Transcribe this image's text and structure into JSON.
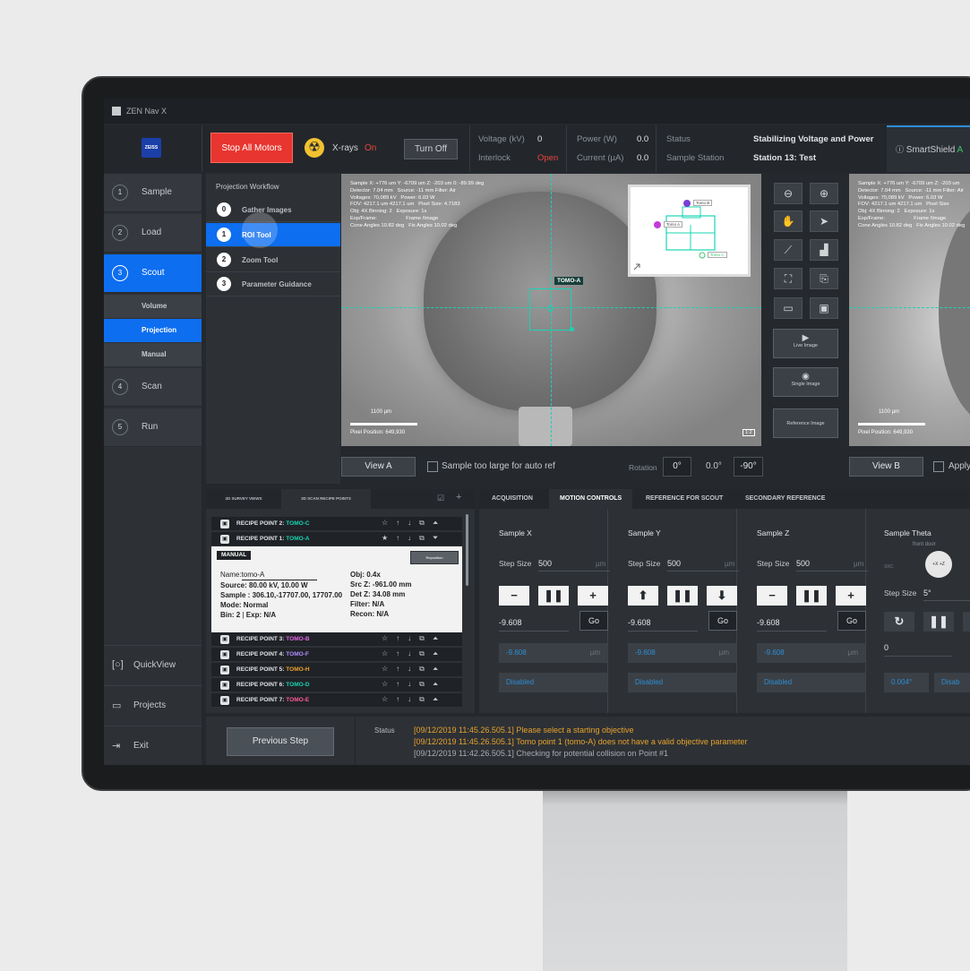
{
  "app_title": "ZEN Nav X",
  "brand": "ZEISS",
  "colors": {
    "accent": "#0d6ef0",
    "danger": "#e8352f",
    "teal": "#18d4b4",
    "warning": "#e8a22b"
  },
  "header": {
    "stop_all_motors": "Stop All Motors",
    "xrays_label": "X-rays",
    "xrays_state": "On",
    "turn_off": "Turn Off",
    "voltage_label": "Voltage (kV)",
    "voltage_value": "0",
    "interlock_label": "Interlock",
    "interlock_value": "Open",
    "power_label": "Power (W)",
    "power_value": "0.0",
    "current_label": "Current (µA)",
    "current_value": "0.0",
    "status_label": "Status",
    "status_value": "Stabilizing Voltage and Power",
    "station_label": "Sample Station",
    "station_value": "Station 13: Test",
    "smartshield": "SmartShield",
    "smartshield_tail": "A"
  },
  "nav": {
    "items": [
      {
        "num": "1",
        "label": "Sample"
      },
      {
        "num": "2",
        "label": "Load"
      },
      {
        "num": "3",
        "label": "Scout"
      },
      {
        "num": "4",
        "label": "Scan"
      },
      {
        "num": "5",
        "label": "Run"
      }
    ],
    "sub": [
      "Volume",
      "Projection",
      "Manual"
    ],
    "bottom": [
      "QuickView",
      "Projects",
      "Exit"
    ]
  },
  "workflow": {
    "title": "Projection Workflow",
    "steps": [
      {
        "num": "0",
        "label": "Gather Images"
      },
      {
        "num": "1",
        "label": "ROI Tool"
      },
      {
        "num": "2",
        "label": "Zoom Tool"
      },
      {
        "num": "3",
        "label": "Parameter Guidance"
      }
    ]
  },
  "viewA": {
    "info": "Sample X: +776 um Y: -6709 um Z: -203 um 0: -89.99 deg\nDetector: 7.04 mm   Source: -11 mm Filter: Air\nVoltages: 70,089 kV   Power: 6.03 W\nFOV: 4217.1 um 4217.1 um   Pixel Size: 4.7183\nObj: 4X Binning: 2   Exposure: 1s\nExp/Frame:                    Frame /Image\nCone Angles 10.82 deg   Fix Angles 10.02 deg",
    "roi_label": "TOMO-A",
    "minimap_labels": [
      "Tomo B",
      "Tomo A",
      "Tomo C"
    ],
    "scale": "1100 µm",
    "pixel_position": "Pixel Position: 649,930",
    "ratio": "1:2",
    "button": "View A",
    "checkbox_label": "Sample too large for auto ref",
    "rotation_label": "Rotation",
    "rotations": [
      "0°",
      "0.0°",
      "-90°"
    ]
  },
  "viewB": {
    "info": "Sample X: +776 um Y: -6709 um Z: -203 um\nDetector: 7.04 mm   Source: -11 mm Filter: Air\nVoltages: 70,089 kV   Power: 6.03 W\nFOV: 4217.1 um 4217.1 um   Pixel Size\nObj: 4X Binning: 2   Exposure: 1s\nExp/Frame:                    Frame /Image\nCone Angles 10.82 deg   Fix Angles 10.02 deg",
    "scale": "1100 µm",
    "pixel_position": "Pixel Position: 649,930",
    "button": "View B",
    "checkbox_label": "Apply"
  },
  "tools": {
    "live": "Live Image",
    "single": "Single Image",
    "reference": "Reference Image"
  },
  "recipe": {
    "tabs": [
      "2D SURVEY VIEWS",
      "3D SCAN RECIPE POINTS"
    ],
    "rows_top": [
      {
        "label": "RECIPE POINT 2:",
        "tomo": "TOMO-C",
        "color": "#18d4b4"
      },
      {
        "label": "RECIPE POINT 1:",
        "tomo": "TOMO-A",
        "color": "#18d4b4"
      }
    ],
    "manual": {
      "tag": "MANUAL",
      "reposition": "Reposition",
      "name_label": "Name:",
      "name": "tomo-A",
      "source_label": "Source:",
      "source": "80.00 kV, 10.00 W",
      "sample_label": "Sample :",
      "sample": "306.10,-17707.00, 17707.00",
      "mode_label": "Mode:",
      "mode": "Normal",
      "bin_label": "Bin:",
      "bin": "2",
      "exp_label": "Exp:",
      "exp": "N/A",
      "obj_label": "Obj:",
      "obj": "0.4x",
      "srcz_label": "Src Z:",
      "srcz": "-961.00 mm",
      "detz_label": "Det Z:",
      "detz": "34.08 mm",
      "filter_label": "Filter:",
      "filter": "N/A",
      "recon_label": "Recon:",
      "recon": "N/A"
    },
    "rows_bottom": [
      {
        "label": "RECIPE POINT 3:",
        "tomo": "TOMO-B",
        "color": "#e266e8"
      },
      {
        "label": "RECIPE POINT 4:",
        "tomo": "TOMO-F",
        "color": "#b08cff"
      },
      {
        "label": "RECIPE POINT 5:",
        "tomo": "TOMO-H",
        "color": "#f0a22b"
      },
      {
        "label": "RECIPE POINT 6:",
        "tomo": "TOMO-D",
        "color": "#18d4b4"
      },
      {
        "label": "RECIPE POINT 7:",
        "tomo": "TOMO-E",
        "color": "#ff5a9a"
      }
    ]
  },
  "motion": {
    "tabs": [
      "ACQUISITION",
      "MOTION CONTROLS",
      "REFERENCE FOR SCOUT",
      "SECONDARY REFERENCE"
    ],
    "axes": [
      {
        "name": "Sample X",
        "step_label": "Step Size",
        "step": "500",
        "unit": "µm",
        "pos": "-9.608",
        "go": "Go",
        "readout": "-9.608",
        "status": "Disabled"
      },
      {
        "name": "Sample Y",
        "step_label": "Step Size",
        "step": "500",
        "unit": "µm",
        "pos": "-9.608",
        "go": "Go",
        "readout": "-9.608",
        "status": "Disabled"
      },
      {
        "name": "Sample Z",
        "step_label": "Step Size",
        "step": "500",
        "unit": "µm",
        "pos": "-9.608",
        "go": "Go",
        "readout": "-9.608",
        "status": "Disabled"
      }
    ],
    "theta": {
      "name": "Sample Theta",
      "front_door": "front door",
      "src": "SRC",
      "step_label": "Step Size",
      "step": "5°",
      "pos": "0",
      "readout": "0.004°",
      "status": "Disab"
    }
  },
  "status": {
    "prev_step": "Previous Step",
    "label": "Status",
    "logs": [
      {
        "text": "[09/12/2019 11:45.26.505.1] Please select a starting objective",
        "color": "#e8a22b"
      },
      {
        "text": "[09/12/2019 11:45.26.505.1] Tomo point 1 (tomo-A) does not have a valid objective parameter",
        "color": "#e8a22b"
      },
      {
        "text": "[09/12/2019 11:42.26.505.1] Checking for potential collision on Point #1",
        "color": "#a9adb2"
      }
    ]
  }
}
